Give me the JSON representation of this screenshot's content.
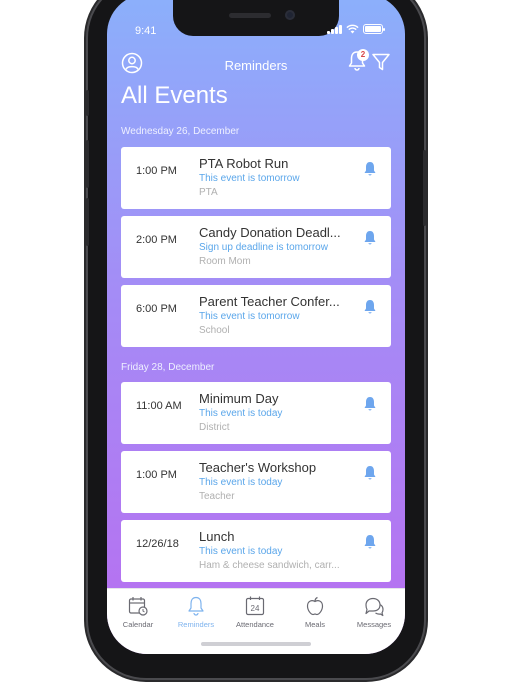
{
  "status": {
    "time": "9:41"
  },
  "header": {
    "title": "Reminders",
    "notification_count": "2",
    "page_title": "All Events"
  },
  "sections": [
    {
      "date": "Wednesday 26, December",
      "events": [
        {
          "time": "1:00 PM",
          "title": "PTA Robot Run",
          "subtitle": "This event is tomorrow",
          "category": "PTA"
        },
        {
          "time": "2:00 PM",
          "title": "Candy Donation Deadl...",
          "subtitle": "Sign up deadline is tomorrow",
          "category": "Room Mom"
        },
        {
          "time": "6:00 PM",
          "title": "Parent Teacher Confer...",
          "subtitle": "This event is tomorrow",
          "category": "School"
        }
      ]
    },
    {
      "date": "Friday 28, December",
      "events": [
        {
          "time": "11:00 AM",
          "title": "Minimum Day",
          "subtitle": "This event is today",
          "category": "District"
        },
        {
          "time": "1:00 PM",
          "title": "Teacher's Workshop",
          "subtitle": "This event is today",
          "category": "Teacher"
        },
        {
          "time": "12/26/18",
          "title": "Lunch",
          "subtitle": "This event is today",
          "category": "Ham & cheese sandwich, carr..."
        }
      ]
    }
  ],
  "tabbar": {
    "tabs": [
      {
        "label": "Calendar",
        "icon": "calendar-icon"
      },
      {
        "label": "Reminders",
        "icon": "bell-icon",
        "active": true
      },
      {
        "label": "Attendance",
        "icon": "attendance-calendar-icon",
        "day": "24"
      },
      {
        "label": "Meals",
        "icon": "apple-icon"
      },
      {
        "label": "Messages",
        "icon": "chat-bubbles-icon"
      }
    ]
  },
  "colors": {
    "gradient_top": "#8bb0fb",
    "gradient_bottom": "#b86ef0",
    "accent_blue": "#5aa6ea",
    "active_tab": "#7eb3ee",
    "bell": "#6ea6ee"
  }
}
